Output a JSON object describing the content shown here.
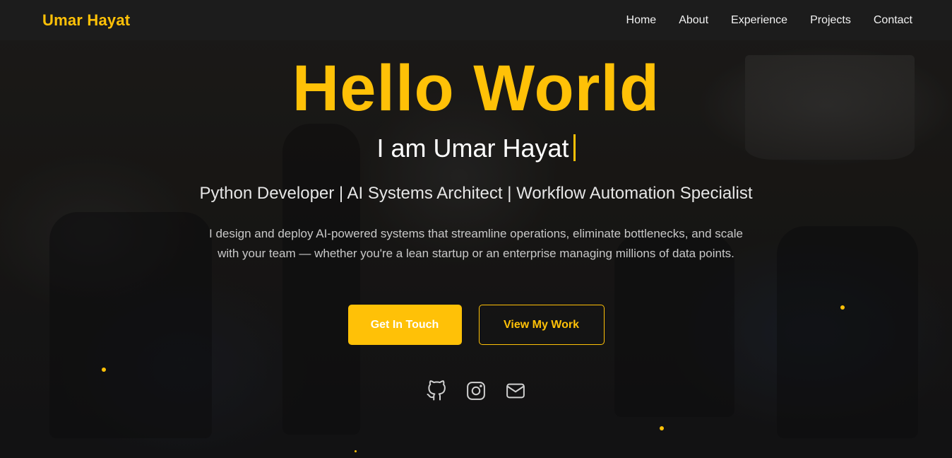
{
  "nav": {
    "brand": "Umar Hayat",
    "links": [
      {
        "label": "Home"
      },
      {
        "label": "About"
      },
      {
        "label": "Experience"
      },
      {
        "label": "Projects"
      },
      {
        "label": "Contact"
      }
    ]
  },
  "hero": {
    "title": "Hello World",
    "subtitle": "I am Umar Hayat",
    "roles": "Python Developer | AI Systems Architect | Workflow Automation Specialist",
    "description": "I design and deploy AI-powered systems that streamline operations, eliminate bottlenecks, and scale with your team — whether you're a lean startup or an enterprise managing millions of data points.",
    "primary_button": "Get In Touch",
    "secondary_button": "View My Work"
  },
  "socials": [
    {
      "icon": "github-icon"
    },
    {
      "icon": "instagram-icon"
    },
    {
      "icon": "mail-icon"
    }
  ],
  "colors": {
    "accent": "#ffc107",
    "navbar": "#1c1c1c",
    "text": "#ffffff"
  }
}
